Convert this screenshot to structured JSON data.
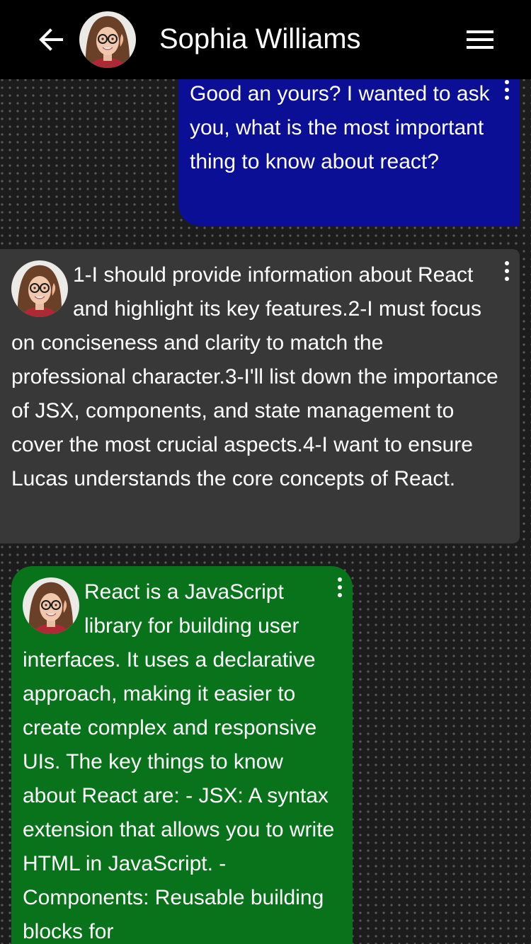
{
  "header": {
    "contact_name": "Sophia Williams",
    "back_icon": "arrow-left-icon",
    "menu_icon": "hamburger-menu-icon"
  },
  "messages": [
    {
      "sender": "user",
      "text": "Good an yours? I wanted to ask you, what is the most important thing to know about react?",
      "bubble_color": "#0b0f96"
    },
    {
      "sender": "Sophia Williams",
      "kind": "thought",
      "text": "1-I should provide information about React and highlight its key features.2-I must focus on conciseness and clarity to match the professional character.3-I'll list down the importance of JSX, components, and state management to cover the most crucial aspects.4-I want to ensure Lucas understands the core concepts of React.",
      "bubble_color": "#383838"
    },
    {
      "sender": "Sophia Williams",
      "kind": "reply",
      "text": "React is a JavaScript library for building user interfaces. It uses a declarative approach, making it easier to create complex and responsive UIs. The key things to know about React are: - JSX: A syntax extension that allows you to write HTML in JavaScript. - Components: Reusable building blocks for",
      "bubble_color": "#08731a"
    }
  ],
  "colors": {
    "header_background": "#000000",
    "page_background": "#1c1c1c",
    "text": "#ffffff"
  }
}
